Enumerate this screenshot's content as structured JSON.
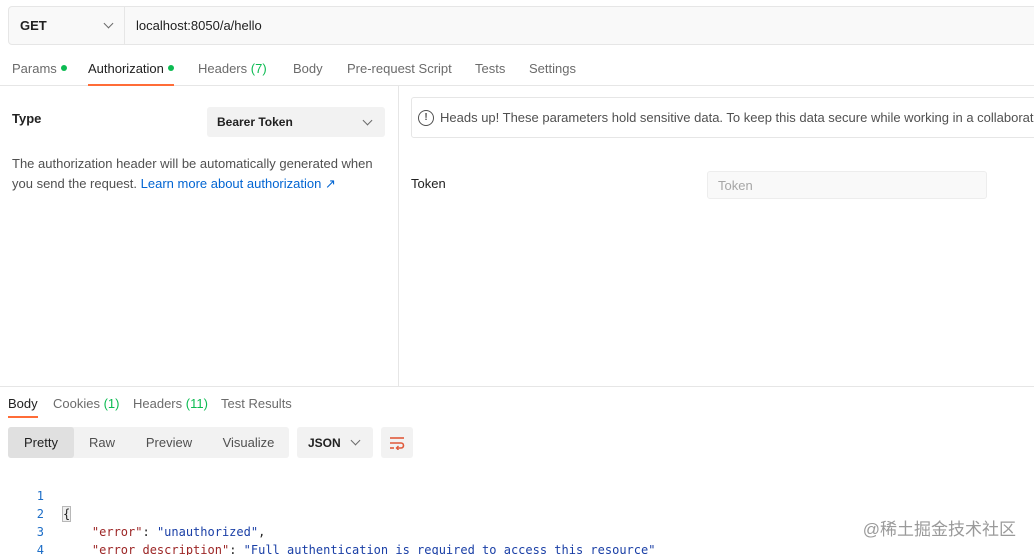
{
  "request": {
    "method": "GET",
    "url": "localhost:8050/a/hello"
  },
  "request_tabs": [
    {
      "label": "Params",
      "dot": true
    },
    {
      "label": "Authorization",
      "dot": true
    },
    {
      "label": "Headers",
      "count": "(7)"
    },
    {
      "label": "Body"
    },
    {
      "label": "Pre-request Script"
    },
    {
      "label": "Tests"
    },
    {
      "label": "Settings"
    }
  ],
  "auth": {
    "type_label": "Type",
    "type_value": "Bearer Token",
    "description": "The authorization header will be automatically generated when you send the request. ",
    "learn_more": "Learn more about authorization ↗",
    "notice": "Heads up! These parameters hold sensitive data. To keep this data secure while working in a collaborative",
    "token_label": "Token",
    "token_placeholder": "Token"
  },
  "response_tabs": [
    {
      "label": "Body"
    },
    {
      "label": "Cookies",
      "count": "(1)"
    },
    {
      "label": "Headers",
      "count": "(11)"
    },
    {
      "label": "Test Results"
    }
  ],
  "view_modes": [
    "Pretty",
    "Raw",
    "Preview",
    "Visualize"
  ],
  "format": "JSON",
  "code": {
    "line_numbers": [
      "1",
      "2",
      "3",
      "4"
    ],
    "open_brace": "{",
    "close_brace": "}",
    "error_key": "\"error\"",
    "error_value": "\"unauthorized\"",
    "desc_key": "\"error_description\"",
    "desc_value": "\"Full authentication is required to access this resource\""
  },
  "watermark": "@稀土掘金技术社区",
  "colors": {
    "accent": "#ff6c37",
    "success": "#0cbb52",
    "link": "#0265d2"
  }
}
